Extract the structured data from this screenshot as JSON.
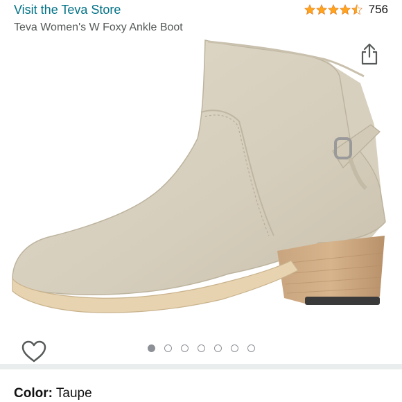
{
  "header": {
    "store_link": "Visit the Teva Store",
    "rating_value": 4.5,
    "rating_count": "756",
    "product_title": "Teva Women's W Foxy Ankle Boot"
  },
  "gallery": {
    "image_alt": "Taupe ankle boot with stacked heel",
    "total_images": 7,
    "active_index": 0
  },
  "variation": {
    "label": "Color:",
    "value": "Taupe"
  },
  "colors": {
    "link": "#007185",
    "star": "#ffa41c",
    "dot": "#8d9096",
    "divider": "#eaeded"
  },
  "icons": {
    "share": "share-icon",
    "wishlist": "heart-icon"
  }
}
